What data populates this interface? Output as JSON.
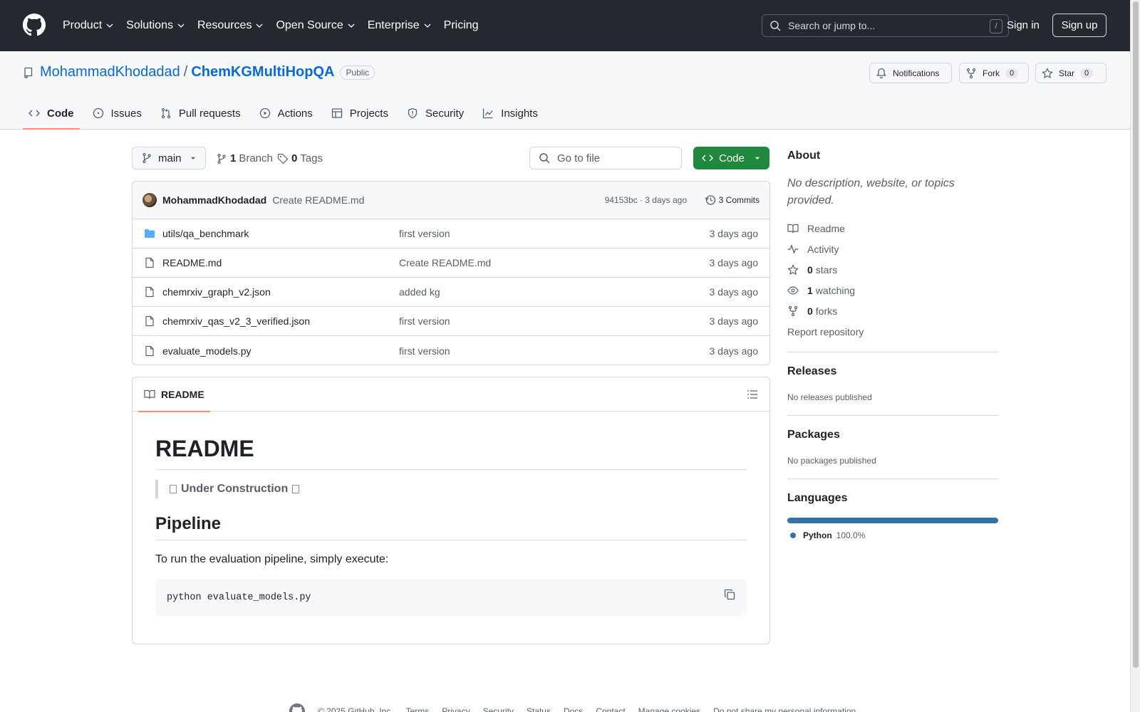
{
  "header": {
    "nav": [
      "Product",
      "Solutions",
      "Resources",
      "Open Source",
      "Enterprise",
      "Pricing"
    ],
    "search_placeholder": "Search or jump to...",
    "search_shortcut": "/",
    "signin": "Sign in",
    "signup": "Sign up"
  },
  "repo": {
    "owner": "MohammadKhodadad",
    "separator": "/",
    "name": "ChemKGMultiHopQA",
    "visibility": "Public",
    "notifications": "Notifications",
    "fork_label": "Fork",
    "fork_count": "0",
    "star_label": "Star",
    "star_count": "0"
  },
  "tabs": [
    {
      "label": "Code",
      "icon": "code-icon"
    },
    {
      "label": "Issues",
      "icon": "issue-icon"
    },
    {
      "label": "Pull requests",
      "icon": "pull-request-icon"
    },
    {
      "label": "Actions",
      "icon": "play-icon"
    },
    {
      "label": "Projects",
      "icon": "table-icon"
    },
    {
      "label": "Security",
      "icon": "shield-icon"
    },
    {
      "label": "Insights",
      "icon": "graph-icon"
    }
  ],
  "toolbar": {
    "branch": "main",
    "branch_count": "1",
    "branch_label": "Branch",
    "tag_count": "0",
    "tag_label": "Tags",
    "goto_placeholder": "Go to file",
    "code_button": "Code"
  },
  "commit": {
    "author": "MohammadKhodadad",
    "message": "Create README.md",
    "sha_time": "94153bc · 3 days ago",
    "commits_label": "3 Commits"
  },
  "files": [
    {
      "name": "utils/qa_benchmark",
      "type": "folder",
      "message": "first version",
      "date": "3 days ago"
    },
    {
      "name": "README.md",
      "type": "file",
      "message": "Create README.md",
      "date": "3 days ago"
    },
    {
      "name": "chemrxiv_graph_v2.json",
      "type": "file",
      "message": "added kg",
      "date": "3 days ago"
    },
    {
      "name": "chemrxiv_qas_v2_3_verified.json",
      "type": "file",
      "message": "first version",
      "date": "3 days ago"
    },
    {
      "name": "evaluate_models.py",
      "type": "file",
      "message": "first version",
      "date": "3 days ago"
    }
  ],
  "readme": {
    "tab": "README",
    "h1": "README",
    "quote": "Under Construction",
    "h2": "Pipeline",
    "paragraph": "To run the evaluation pipeline, simply execute:",
    "code": "python evaluate_models.py"
  },
  "sidebar": {
    "about_title": "About",
    "description": "No description, website, or topics provided.",
    "readme": "Readme",
    "activity": "Activity",
    "stars_count": "0",
    "stars_label": "stars",
    "watching_count": "1",
    "watching_label": "watching",
    "forks_count": "0",
    "forks_label": "forks",
    "report": "Report repository",
    "releases_title": "Releases",
    "releases_text": "No releases published",
    "packages_title": "Packages",
    "packages_text": "No packages published",
    "languages_title": "Languages",
    "language_name": "Python",
    "language_pct": "100.0%",
    "language_color": "#3572A5"
  },
  "footer": {
    "copyright": "© 2025 GitHub, Inc.",
    "links": [
      "Terms",
      "Privacy",
      "Security",
      "Status",
      "Docs",
      "Contact",
      "Manage cookies",
      "Do not share my personal information"
    ]
  }
}
